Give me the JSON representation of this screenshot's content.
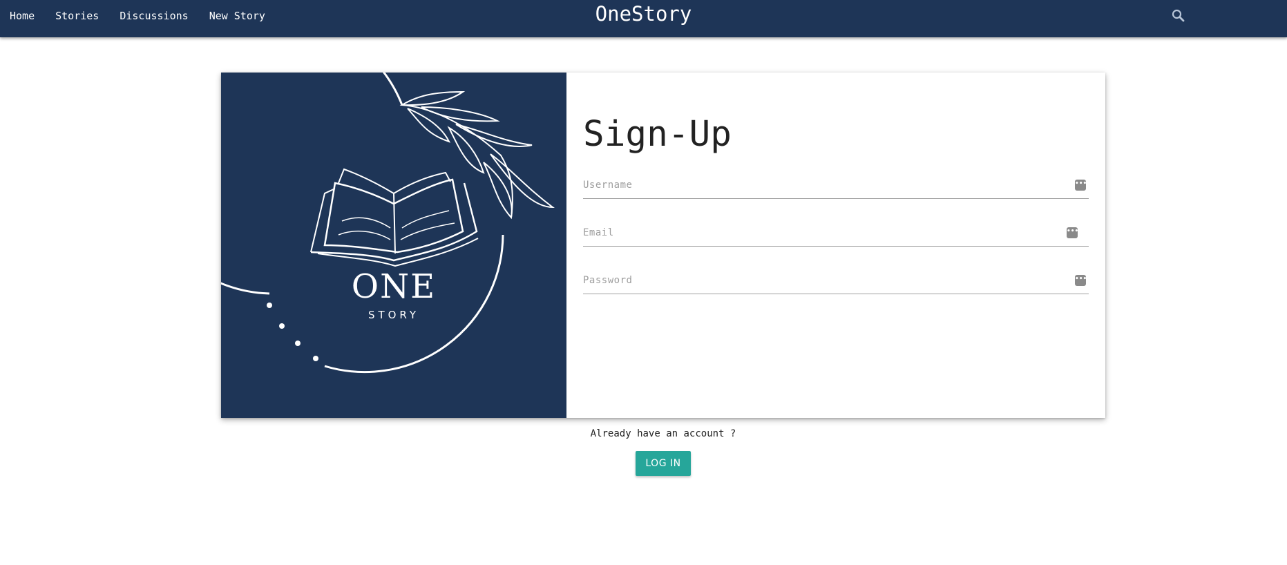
{
  "app": {
    "title": "OneStory"
  },
  "nav": {
    "links": [
      {
        "label": "Home"
      },
      {
        "label": "Stories"
      },
      {
        "label": "Discussions"
      },
      {
        "label": "New Story"
      }
    ],
    "search_icon": "magnifier-icon"
  },
  "logo": {
    "one": "ONE",
    "story": "STORY",
    "icon": "open-book-with-leaf-branch"
  },
  "signup": {
    "title": "Sign-Up",
    "username_placeholder": "Username",
    "email_placeholder": "Email",
    "password_placeholder": "Password",
    "username_value": "",
    "email_value": "",
    "password_value": "",
    "field_icon": "password-manager-dots-icon"
  },
  "footer": {
    "already_text": "Already have an account ?",
    "login_label": "LOG IN"
  },
  "colors": {
    "navy": "#1e3557",
    "teal": "#26a69a",
    "white": "#ffffff"
  }
}
